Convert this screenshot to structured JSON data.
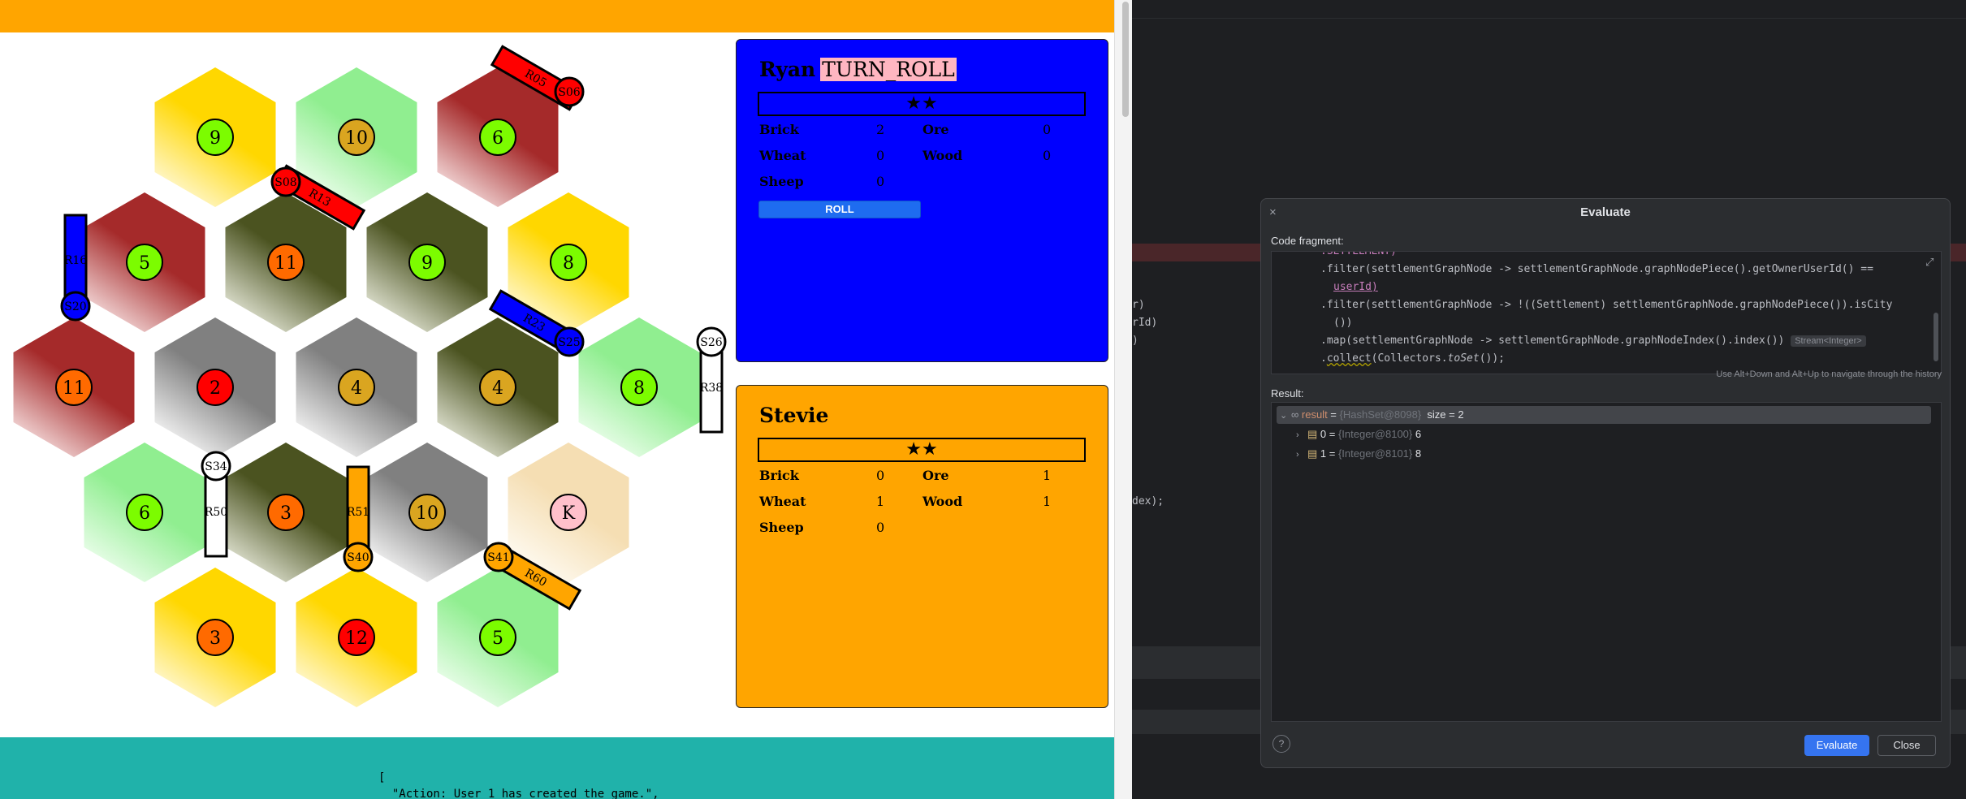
{
  "game": {
    "tiles": [
      {
        "id": "t1",
        "color": "wheat",
        "number": "9"
      },
      {
        "id": "t2",
        "color": "sheep",
        "number": "10"
      },
      {
        "id": "t3",
        "color": "brick",
        "number": "6"
      },
      {
        "id": "t4",
        "color": "brick",
        "number": "5"
      },
      {
        "id": "t5",
        "color": "wood",
        "number": "11"
      },
      {
        "id": "t6",
        "color": "wood",
        "number": "9"
      },
      {
        "id": "t7",
        "color": "wheat",
        "number": "8"
      },
      {
        "id": "t8",
        "color": "brick",
        "number": "11"
      },
      {
        "id": "t9",
        "color": "ore",
        "number": "2"
      },
      {
        "id": "t10",
        "color": "ore",
        "number": "4"
      },
      {
        "id": "t11",
        "color": "wood",
        "number": "4"
      },
      {
        "id": "t12",
        "color": "sheep",
        "number": "8"
      },
      {
        "id": "t13",
        "color": "sheep",
        "number": "6"
      },
      {
        "id": "t14",
        "color": "wood",
        "number": "3"
      },
      {
        "id": "t15",
        "color": "ore",
        "number": "10"
      },
      {
        "id": "t16",
        "color": "desert",
        "number": "K"
      },
      {
        "id": "t17",
        "color": "wheat",
        "number": "3"
      },
      {
        "id": "t18",
        "color": "wheat",
        "number": "12"
      },
      {
        "id": "t19",
        "color": "sheep",
        "number": "5"
      }
    ],
    "roads": [
      {
        "label": "R05",
        "color": "#ff0000"
      },
      {
        "label": "R13",
        "color": "#ff0000"
      },
      {
        "label": "R16",
        "color": "#0000ff"
      },
      {
        "label": "R23",
        "color": "#0000ff"
      },
      {
        "label": "R38",
        "color": "#ffffff"
      },
      {
        "label": "R50",
        "color": "#ffffff"
      },
      {
        "label": "R51",
        "color": "#ffa500"
      },
      {
        "label": "R60",
        "color": "#ffa500"
      }
    ],
    "settlements": [
      {
        "label": "S06",
        "color": "#ff0000"
      },
      {
        "label": "S08",
        "color": "#ff0000"
      },
      {
        "label": "S20",
        "color": "#0000ff"
      },
      {
        "label": "S25",
        "color": "#0000ff"
      },
      {
        "label": "S26",
        "color": "#ffffff"
      },
      {
        "label": "S34",
        "color": "#ffffff"
      },
      {
        "label": "S40",
        "color": "#ffa500"
      },
      {
        "label": "S41",
        "color": "#ffa500"
      }
    ],
    "colors": {
      "top_bar": "#ffa500",
      "log_bg": "#20b2aa",
      "ryan": "#0000ff",
      "stevie": "#ffa500"
    },
    "players": [
      {
        "name": "Ryan",
        "state": "TURN_ROLL",
        "stars": "★★",
        "resources": {
          "brick_label": "Brick",
          "brick": "2",
          "ore_label": "Ore",
          "ore": "0",
          "wheat_label": "Wheat",
          "wheat": "0",
          "wood_label": "Wood",
          "wood": "0",
          "sheep_label": "Sheep",
          "sheep": "0"
        },
        "roll_label": "ROLL"
      },
      {
        "name": "Stevie",
        "stars": "★★",
        "resources": {
          "brick_label": "Brick",
          "brick": "0",
          "ore_label": "Ore",
          "ore": "1",
          "wheat_label": "Wheat",
          "wheat": "1",
          "wood_label": "Wood",
          "wood": "1",
          "sheep_label": "Sheep",
          "sheep": "0"
        }
      }
    ],
    "log": {
      "line1": "[",
      "line2": "  \"Action: User 1 has created the game.\","
    }
  },
  "ide": {
    "background_fragments": [
      "r)",
      "rId)",
      ")",
      "dex);"
    ],
    "dialog": {
      "title": "Evaluate",
      "close_x": "×",
      "fragment_label": "Code fragment:",
      "code": {
        "line0": ".SETTLEMENT)",
        "line1": ".filter(settlementGraphNode -> settlementGraphNode.graphNodePiece().getOwnerUserId() ==",
        "line1b": "userId)",
        "line2": ".filter(settlementGraphNode -> !((Settlement) settlementGraphNode.graphNodePiece()).isCity",
        "line2b": "())",
        "line3": ".map(settlementGraphNode -> settlementGraphNode.graphNodeIndex().index())",
        "line3_hint": "Stream<Integer>",
        "line4_pre": ".",
        "line4_collect": "collect",
        "line4_post": "(Collectors.",
        "line4_toset": "toSet",
        "line4_end": "());"
      },
      "history_hint": "Use Alt+Down and Alt+Up to navigate through the history",
      "result_label": "Result:",
      "result": {
        "root_name": "result",
        "root_eq": " = ",
        "root_type": "{HashSet@8098}",
        "root_size": "  size = 2",
        "items": [
          {
            "name": "0",
            "eq": " = ",
            "type": "{Integer@8100}",
            "value": " 6"
          },
          {
            "name": "1",
            "eq": " = ",
            "type": "{Integer@8101}",
            "value": " 8"
          }
        ]
      },
      "help": "?",
      "evaluate_btn": "Evaluate",
      "close_btn": "Close"
    }
  }
}
